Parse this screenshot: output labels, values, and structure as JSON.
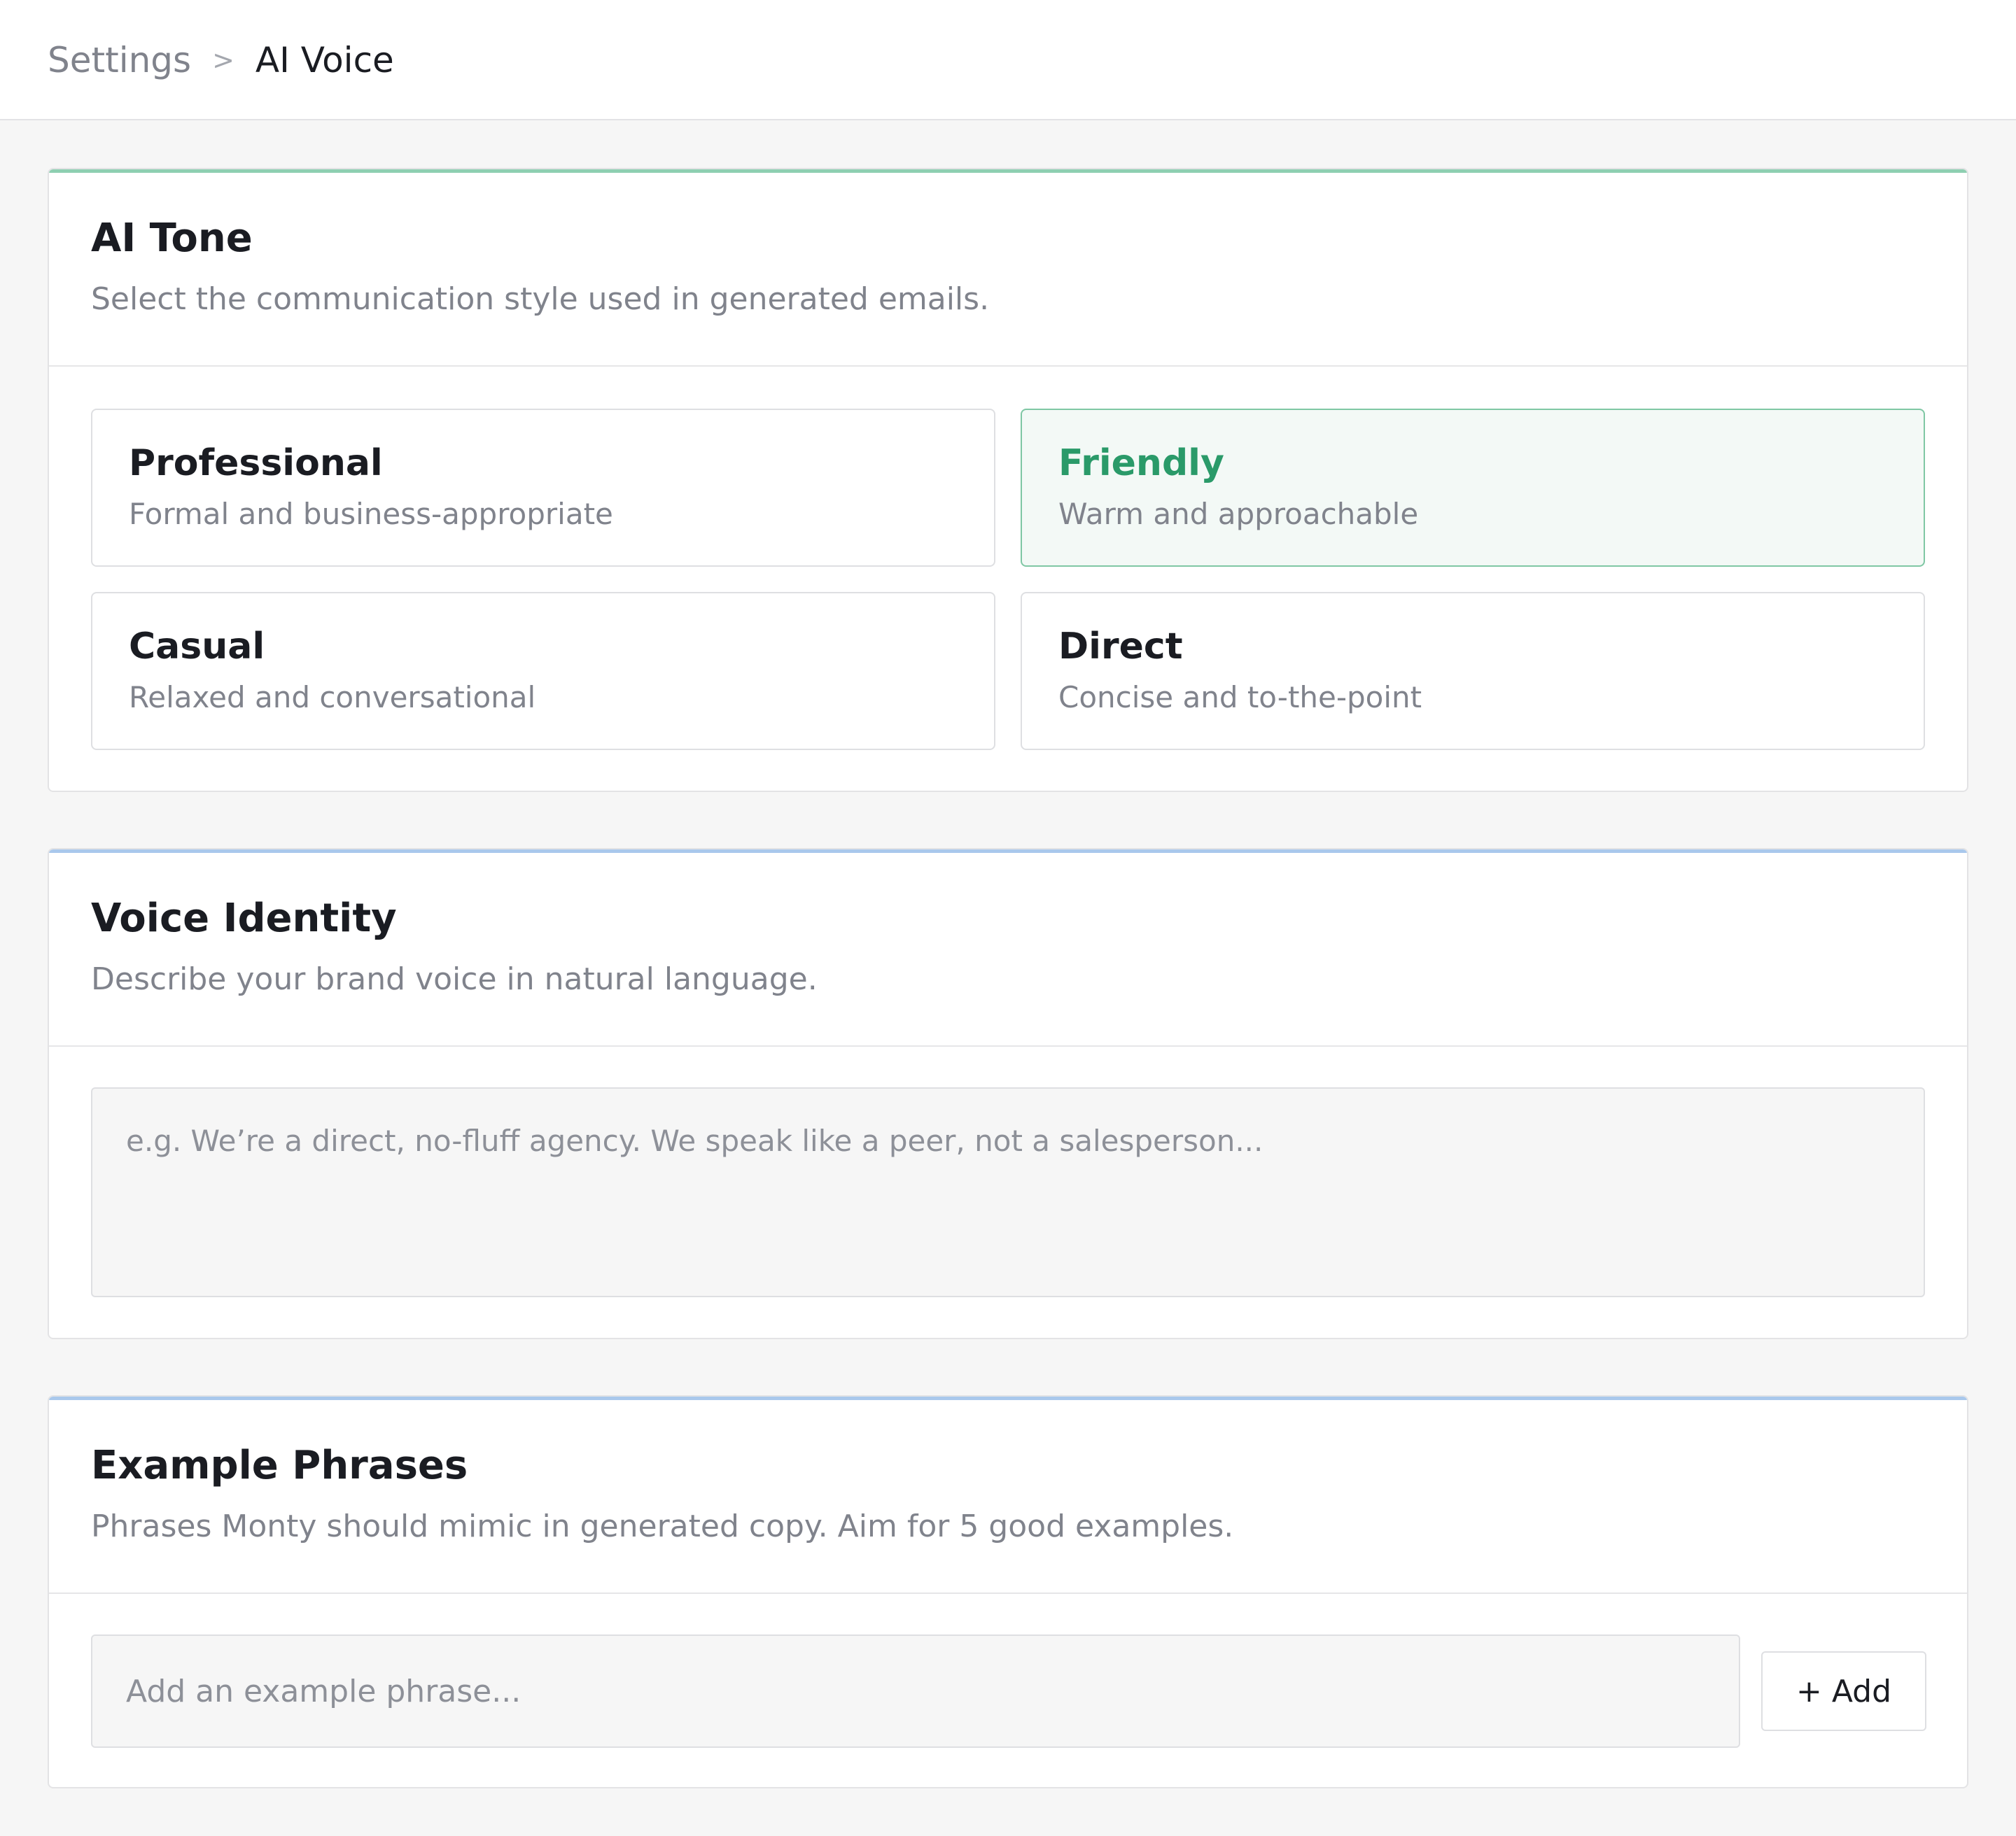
{
  "breadcrumb": {
    "parent": "Settings",
    "separator": ">",
    "current": "AI Voice"
  },
  "colors": {
    "tone_accent": "#8ecfb1",
    "voice_accent": "#a9c8ec",
    "examples_accent": "#a9c8ec",
    "selected_text": "#2a9a69",
    "selected_border": "#7fc7a4"
  },
  "ai_tone": {
    "title": "AI Tone",
    "description": "Select the communication style used in generated emails.",
    "selected": "Friendly",
    "options": [
      {
        "name": "Professional",
        "description": "Formal and business-appropriate"
      },
      {
        "name": "Friendly",
        "description": "Warm and approachable"
      },
      {
        "name": "Casual",
        "description": "Relaxed and conversational"
      },
      {
        "name": "Direct",
        "description": "Concise and to-the-point"
      }
    ]
  },
  "voice_identity": {
    "title": "Voice Identity",
    "description": "Describe your brand voice in natural language.",
    "value": "",
    "placeholder": "e.g. We’re a direct, no-fluff agency. We speak like a peer, not a salesperson..."
  },
  "example_phrases": {
    "title": "Example Phrases",
    "description": "Phrases Monty should mimic in generated copy. Aim for 5 good examples.",
    "input_value": "",
    "input_placeholder": "Add an example phrase...",
    "add_label": "+ Add"
  }
}
